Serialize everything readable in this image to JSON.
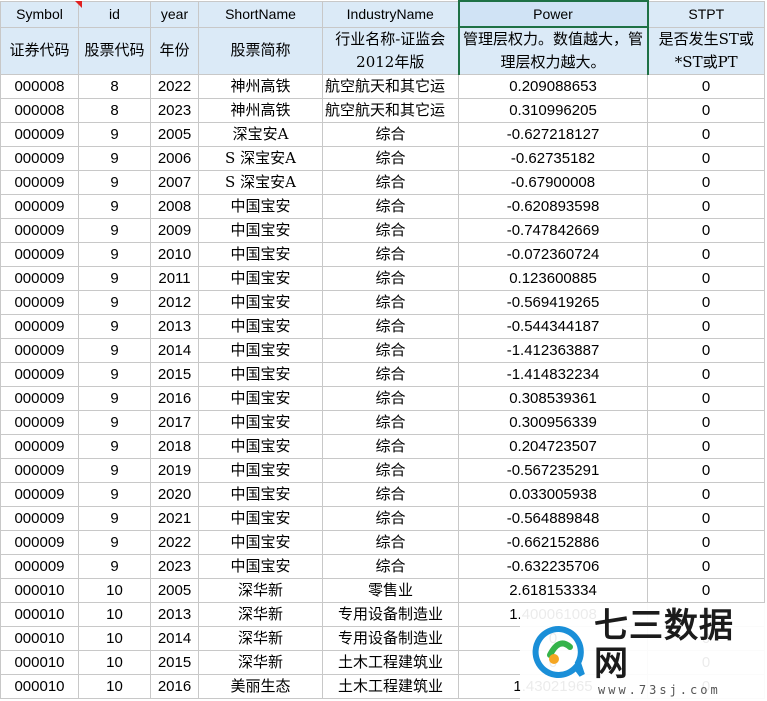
{
  "header": {
    "row1": [
      "Symbol",
      "id",
      "year",
      "ShortName",
      "IndustryName",
      "Power",
      "STPT"
    ],
    "row2": [
      "证券代码",
      "股票代码",
      "年份",
      "股票简称",
      "行业名称-证监会2012年版",
      "管理层权力。数值越大，管理层权力越大。",
      "是否发生ST或*ST或PT"
    ]
  },
  "rows": [
    [
      "000008",
      "8",
      "2022",
      "神州高铁",
      "航空航天和其它运",
      "0.209088653",
      "0"
    ],
    [
      "000008",
      "8",
      "2023",
      "神州高铁",
      "航空航天和其它运",
      "0.310996205",
      "0"
    ],
    [
      "000009",
      "9",
      "2005",
      "深宝安A",
      "综合",
      "-0.627218127",
      "0"
    ],
    [
      "000009",
      "9",
      "2006",
      "S 深宝安A",
      "综合",
      "-0.62735182",
      "0"
    ],
    [
      "000009",
      "9",
      "2007",
      "S 深宝安A",
      "综合",
      "-0.67900008",
      "0"
    ],
    [
      "000009",
      "9",
      "2008",
      "中国宝安",
      "综合",
      "-0.620893598",
      "0"
    ],
    [
      "000009",
      "9",
      "2009",
      "中国宝安",
      "综合",
      "-0.747842669",
      "0"
    ],
    [
      "000009",
      "9",
      "2010",
      "中国宝安",
      "综合",
      "-0.072360724",
      "0"
    ],
    [
      "000009",
      "9",
      "2011",
      "中国宝安",
      "综合",
      "0.123600885",
      "0"
    ],
    [
      "000009",
      "9",
      "2012",
      "中国宝安",
      "综合",
      "-0.569419265",
      "0"
    ],
    [
      "000009",
      "9",
      "2013",
      "中国宝安",
      "综合",
      "-0.544344187",
      "0"
    ],
    [
      "000009",
      "9",
      "2014",
      "中国宝安",
      "综合",
      "-1.412363887",
      "0"
    ],
    [
      "000009",
      "9",
      "2015",
      "中国宝安",
      "综合",
      "-1.414832234",
      "0"
    ],
    [
      "000009",
      "9",
      "2016",
      "中国宝安",
      "综合",
      "0.308539361",
      "0"
    ],
    [
      "000009",
      "9",
      "2017",
      "中国宝安",
      "综合",
      "0.300956339",
      "0"
    ],
    [
      "000009",
      "9",
      "2018",
      "中国宝安",
      "综合",
      "0.204723507",
      "0"
    ],
    [
      "000009",
      "9",
      "2019",
      "中国宝安",
      "综合",
      "-0.567235291",
      "0"
    ],
    [
      "000009",
      "9",
      "2020",
      "中国宝安",
      "综合",
      "0.033005938",
      "0"
    ],
    [
      "000009",
      "9",
      "2021",
      "中国宝安",
      "综合",
      "-0.564889848",
      "0"
    ],
    [
      "000009",
      "9",
      "2022",
      "中国宝安",
      "综合",
      "-0.662152886",
      "0"
    ],
    [
      "000009",
      "9",
      "2023",
      "中国宝安",
      "综合",
      "-0.632235706",
      "0"
    ],
    [
      "000010",
      "10",
      "2005",
      "深华新",
      "零售业",
      "2.618153334",
      "0"
    ],
    [
      "000010",
      "10",
      "2013",
      "深华新",
      "专用设备制造业",
      "1.400061008",
      "0"
    ],
    [
      "000010",
      "10",
      "2014",
      "深华新",
      "专用设备制造业",
      "0",
      "0"
    ],
    [
      "000010",
      "10",
      "2015",
      "深华新",
      "土木工程建筑业",
      "0",
      "0"
    ],
    [
      "000010",
      "10",
      "2016",
      "美丽生态",
      "土木工程建筑业",
      "1.43021965",
      "0"
    ]
  ],
  "watermark": {
    "title": "七三数据网",
    "url": "www.73sj.com",
    "logo_colors": [
      "#1a8fd8",
      "#35b34a",
      "#f5a623"
    ],
    "logo_icon": "chat-bubble-logo-icon"
  },
  "colors": {
    "header_bg": "#dbeaf7",
    "selected_border": "#1e7145",
    "comment_marker": "#e02020",
    "gridline": "#c8c8c8"
  }
}
